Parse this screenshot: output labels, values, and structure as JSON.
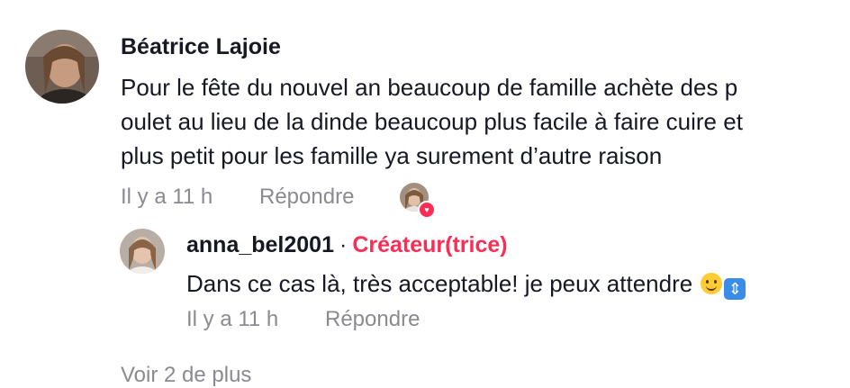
{
  "comment": {
    "author": "Béatrice Lajoie",
    "text_lines": [
      "Pour le fête du nouvel an beaucoup de famille achète des p",
      "oulet au lieu de la dinde beaucoup plus facile à faire cuire et",
      "plus petit pour les famille ya surement d’autre raison"
    ],
    "time": "Il y a 11 h",
    "reply_label": "Répondre",
    "liked_by_creator_icon": "heart-icon",
    "reply": {
      "author": "anna_bel2001",
      "separator": "·",
      "badge": "Créateur(trice)",
      "text": "Dans ce cas là, très acceptable! je peux attendre",
      "emojis": [
        "slightly-smiling-face",
        "up-down-arrow"
      ],
      "time": "Il y a 11 h",
      "reply_label": "Répondre"
    },
    "view_more": "Voir 2 de plus"
  },
  "colors": {
    "text": "#161823",
    "muted": "#8a8b91",
    "accent": "#fe2c55"
  }
}
